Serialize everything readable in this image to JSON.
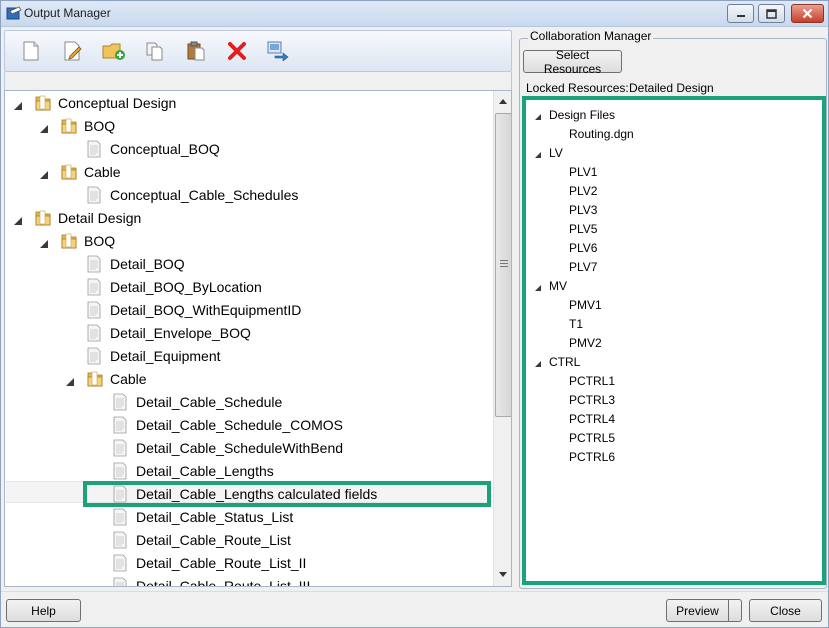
{
  "window": {
    "title": "Output Manager"
  },
  "toolbar": {
    "buttons": [
      {
        "icon": "new-document-icon"
      },
      {
        "icon": "edit-document-icon"
      },
      {
        "icon": "add-folder-icon"
      },
      {
        "icon": "copy-icon"
      },
      {
        "icon": "paste-icon"
      },
      {
        "icon": "delete-icon"
      },
      {
        "icon": "export-icon"
      }
    ]
  },
  "output_tree": {
    "nodes": [
      {
        "label": "Conceptual Design",
        "type": "folder",
        "level": 0,
        "expanded": true
      },
      {
        "label": "BOQ",
        "type": "folder",
        "level": 1,
        "expanded": true
      },
      {
        "label": "Conceptual_BOQ",
        "type": "report",
        "level": 2
      },
      {
        "label": "Cable",
        "type": "folder",
        "level": 1,
        "expanded": true
      },
      {
        "label": "Conceptual_Cable_Schedules",
        "type": "report",
        "level": 2
      },
      {
        "label": "Detail Design",
        "type": "folder",
        "level": 0,
        "expanded": true
      },
      {
        "label": "BOQ",
        "type": "folder",
        "level": 1,
        "expanded": true
      },
      {
        "label": "Detail_BOQ",
        "type": "report",
        "level": 2
      },
      {
        "label": "Detail_BOQ_ByLocation",
        "type": "report",
        "level": 2
      },
      {
        "label": "Detail_BOQ_WithEquipmentID",
        "type": "report",
        "level": 2
      },
      {
        "label": "Detail_Envelope_BOQ",
        "type": "report",
        "level": 2
      },
      {
        "label": "Detail_Equipment",
        "type": "report",
        "level": 2
      },
      {
        "label": "Cable",
        "type": "folder",
        "level": 2,
        "expanded": true
      },
      {
        "label": "Detail_Cable_Schedule",
        "type": "report",
        "level": 3
      },
      {
        "label": "Detail_Cable_Schedule_COMOS",
        "type": "report",
        "level": 3
      },
      {
        "label": "Detail_Cable_ScheduleWithBend",
        "type": "report",
        "level": 3
      },
      {
        "label": "Detail_Cable_Lengths",
        "type": "report",
        "level": 3
      },
      {
        "label": "Detail_Cable_Lengths calculated fields",
        "type": "report",
        "level": 3,
        "highlighted": true
      },
      {
        "label": "Detail_Cable_Status_List",
        "type": "report",
        "level": 3
      },
      {
        "label": "Detail_Cable_Route_List",
        "type": "report",
        "level": 3
      },
      {
        "label": "Detail_Cable_Route_List_II",
        "type": "report",
        "level": 3
      },
      {
        "label": "Detail_Cable_Route_List_III",
        "type": "report",
        "level": 3
      }
    ]
  },
  "collaboration": {
    "group_title": "Collaboration Manager",
    "select_resources_label": "Select Resources",
    "locked_resources_label": "Locked Resources:",
    "locked_resources_value": "Detailed Design",
    "resources": [
      {
        "label": "Design Files",
        "level": 0
      },
      {
        "label": "Routing.dgn",
        "level": 1
      },
      {
        "label": "LV",
        "level": 0
      },
      {
        "label": "PLV1",
        "level": 1
      },
      {
        "label": "PLV2",
        "level": 1
      },
      {
        "label": "PLV3",
        "level": 1
      },
      {
        "label": "PLV5",
        "level": 1
      },
      {
        "label": "PLV6",
        "level": 1
      },
      {
        "label": "PLV7",
        "level": 1
      },
      {
        "label": "MV",
        "level": 0
      },
      {
        "label": "PMV1",
        "level": 1
      },
      {
        "label": "T1",
        "level": 1
      },
      {
        "label": "PMV2",
        "level": 1
      },
      {
        "label": "CTRL",
        "level": 0
      },
      {
        "label": "PCTRL1",
        "level": 1
      },
      {
        "label": "PCTRL3",
        "level": 1
      },
      {
        "label": "PCTRL4",
        "level": 1
      },
      {
        "label": "PCTRL5",
        "level": 1
      },
      {
        "label": "PCTRL6",
        "level": 1
      }
    ]
  },
  "footer": {
    "help_label": "Help",
    "preview_label": "Preview",
    "close_label": "Close"
  },
  "colors": {
    "highlight": "#1aa37a",
    "folder": "#e8b64a",
    "delete": "#e02020"
  }
}
